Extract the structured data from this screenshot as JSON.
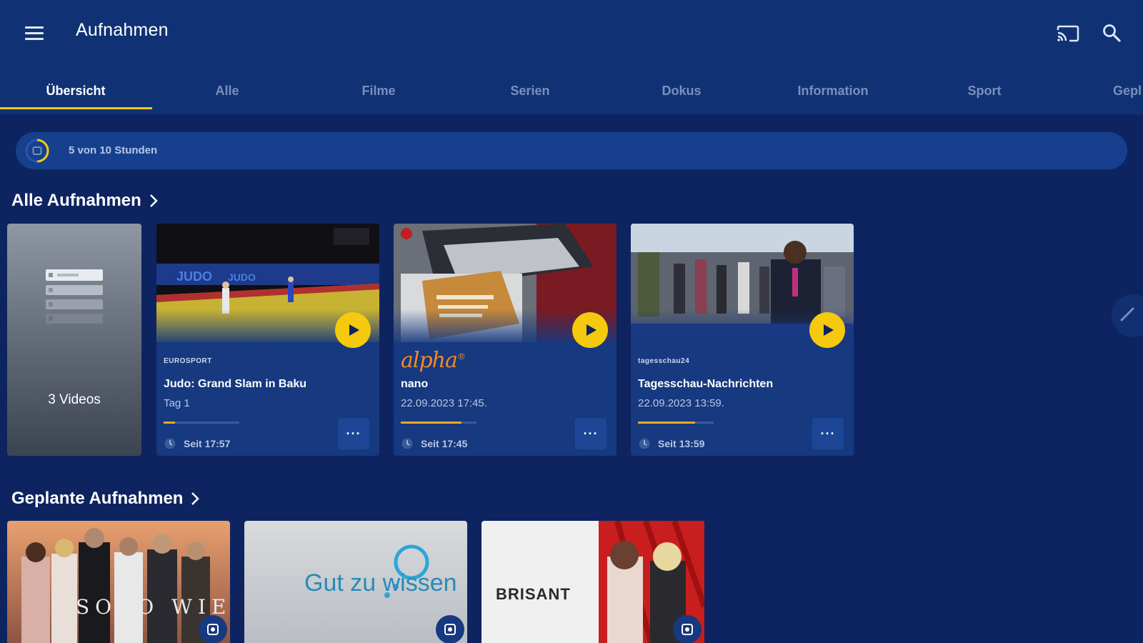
{
  "header": {
    "title": "Aufnahmen",
    "menu_icon": "hamburger-menu-icon",
    "cast_icon": "cast-icon",
    "search_icon": "search-icon"
  },
  "tabs": [
    {
      "label": "Übersicht",
      "active": true
    },
    {
      "label": "Alle",
      "active": false
    },
    {
      "label": "Filme",
      "active": false
    },
    {
      "label": "Serien",
      "active": false
    },
    {
      "label": "Dokus",
      "active": false
    },
    {
      "label": "Information",
      "active": false
    },
    {
      "label": "Sport",
      "active": false
    },
    {
      "label": "Gepl",
      "active": false
    }
  ],
  "storage": {
    "text": "5 von 10 Stunden",
    "used_fraction": 0.5
  },
  "sections": {
    "all_recordings": "Alle Aufnahmen",
    "planned_recordings": "Geplante Aufnahmen"
  },
  "group_card": {
    "label": "3 Videos"
  },
  "recordings": [
    {
      "channel_logo_text": "EUROSPORT",
      "title": "Judo: Grand Slam in Baku",
      "subtitle": "Tag 1",
      "progress": 0.15,
      "time": "Seit 17:57",
      "more": "···"
    },
    {
      "channel_logo_text": "alpha",
      "title": "nano",
      "subtitle": "22.09.2023 17:45.",
      "progress": 0.8,
      "time": "Seit 17:45",
      "more": "···"
    },
    {
      "channel_logo_text": "tagesschau24",
      "title": "Tagesschau-Nachrichten",
      "subtitle": "22.09.2023 13:59.",
      "progress": 0.75,
      "time": "Seit 13:59",
      "more": "···"
    }
  ],
  "planned": [
    {
      "title_art": "SOKO WIEN"
    },
    {
      "title_art": "Gut zu wissen"
    },
    {
      "title_art": "BRISANT"
    }
  ],
  "colors": {
    "accent": "#f5c90c",
    "background": "#0e2460",
    "appbar": "#103274",
    "card": "#16397f",
    "progress": "#f5a623"
  }
}
